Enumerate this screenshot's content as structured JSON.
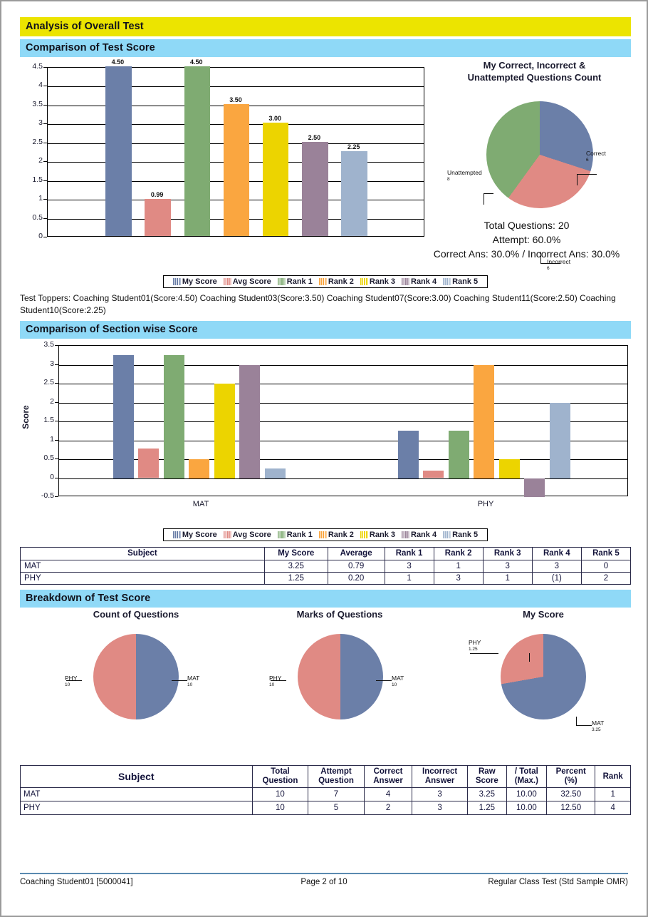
{
  "header": {
    "title": "Analysis of Overall Test"
  },
  "sections": {
    "test_score": {
      "title": "Comparison of Test Score"
    },
    "section_wise": {
      "title": "Comparison of Section wise Score"
    },
    "breakdown": {
      "title": "Breakdown of Test Score"
    }
  },
  "legend": {
    "items": [
      {
        "label": "My Score",
        "color": "#6b7fa8"
      },
      {
        "label": "Avg Score",
        "color": "#e08a84"
      },
      {
        "label": "Rank 1",
        "color": "#7fab72"
      },
      {
        "label": "Rank 2",
        "color": "#faa640"
      },
      {
        "label": "Rank 3",
        "color": "#ecd400"
      },
      {
        "label": "Rank 4",
        "color": "#9a8299"
      },
      {
        "label": "Rank 5",
        "color": "#9fb3cd"
      }
    ]
  },
  "toppers": {
    "text": "Test Toppers: Coaching Student01(Score:4.50) Coaching Student03(Score:3.50) Coaching Student07(Score:3.00) Coaching Student11(Score:2.50) Coaching Student10(Score:2.25)"
  },
  "overall_stats": {
    "total_questions": "Total Questions: 20",
    "attempt": "Attempt: 60.0%",
    "accuracy": "Correct Ans: 30.0% / Incorrect Ans: 30.0%"
  },
  "section_table": {
    "headers": [
      "Subject",
      "My Score",
      "Average",
      "Rank 1",
      "Rank 2",
      "Rank 3",
      "Rank 4",
      "Rank 5"
    ],
    "rows": [
      [
        "MAT",
        "3.25",
        "0.79",
        "3",
        "1",
        "3",
        "3",
        "0"
      ],
      [
        "PHY",
        "1.25",
        "0.20",
        "1",
        "3",
        "1",
        "(1)",
        "2"
      ]
    ]
  },
  "breakdown_table": {
    "headers": [
      "Subject",
      "Total Question",
      "Attempt Question",
      "Correct Answer",
      "Incorrect Answer",
      "Raw Score",
      "/ Total (Max.)",
      "Percent (%)",
      "Rank"
    ],
    "headers_l1": [
      "Subject",
      "Total",
      "Attempt",
      "Correct",
      "Incorrect",
      "Raw",
      "/ Total",
      "Percent",
      "Rank"
    ],
    "headers_l2": [
      "",
      "Question",
      "Question",
      "Answer",
      "Answer",
      "Score",
      "(Max.)",
      "(%)",
      ""
    ],
    "rows": [
      [
        "MAT",
        "10",
        "7",
        "4",
        "3",
        "3.25",
        "10.00",
        "32.50",
        "1"
      ],
      [
        "PHY",
        "10",
        "5",
        "2",
        "3",
        "1.25",
        "10.00",
        "12.50",
        "4"
      ]
    ]
  },
  "footer": {
    "left": "Coaching Student01 [5000041]",
    "center": "Page 2 of 10",
    "right": "Regular Class Test (Std Sample OMR)"
  },
  "chart_data": [
    {
      "id": "overall_bar",
      "type": "bar",
      "title": "",
      "categories": [
        "My Score",
        "Avg Score",
        "Rank 1",
        "Rank 2",
        "Rank 3",
        "Rank 4",
        "Rank 5"
      ],
      "values": [
        4.5,
        0.99,
        4.5,
        3.5,
        3.0,
        2.5,
        2.25
      ],
      "labels": [
        "4.50",
        "0.99",
        "4.50",
        "3.50",
        "3.00",
        "2.50",
        "2.25"
      ],
      "colors": [
        "#6b7fa8",
        "#e08a84",
        "#7fab72",
        "#faa640",
        "#ecd400",
        "#9a8299",
        "#9fb3cd"
      ],
      "ylim": [
        0,
        4.5
      ],
      "yticks": [
        "0",
        "0.5",
        "1",
        "1.5",
        "2",
        "2.5",
        "3",
        "3.5",
        "4",
        "4.5"
      ],
      "ylabel": "",
      "xlabel": "",
      "grid": true,
      "legend_position": "bottom"
    },
    {
      "id": "overall_pie",
      "type": "pie",
      "title": "My Correct, Incorrect & Unattempted Questions Count",
      "title_line1": "My Correct, Incorrect &",
      "title_line2": "Unattempted Questions Count",
      "labels": [
        "Correct",
        "Incorrect",
        "Unattempted"
      ],
      "values": [
        6,
        6,
        8
      ],
      "value_labels": [
        "6",
        "6",
        "8"
      ],
      "colors": [
        "#6b7fa8",
        "#e08a84",
        "#7fab72"
      ]
    },
    {
      "id": "section_bar",
      "type": "bar",
      "categories": [
        "MAT",
        "PHY"
      ],
      "ylabel": "Score",
      "ylim": [
        -0.5,
        3.5
      ],
      "yticks": [
        "-0.5",
        "0",
        "0.5",
        "1",
        "1.5",
        "2",
        "2.5",
        "3",
        "3.5"
      ],
      "grid": true,
      "legend_position": "bottom",
      "series": [
        {
          "name": "My Score",
          "color": "#6b7fa8",
          "values": [
            3.25,
            1.25
          ]
        },
        {
          "name": "Avg Score",
          "color": "#e08a84",
          "values": [
            0.79,
            0.2
          ]
        },
        {
          "name": "Rank 1",
          "color": "#7fab72",
          "values": [
            3.25,
            1.25
          ]
        },
        {
          "name": "Rank 2",
          "color": "#faa640",
          "values": [
            0.5,
            3.0
          ]
        },
        {
          "name": "Rank 3",
          "color": "#ecd400",
          "values": [
            2.5,
            0.5
          ]
        },
        {
          "name": "Rank 4",
          "color": "#9a8299",
          "values": [
            3.0,
            -0.5
          ]
        },
        {
          "name": "Rank 5",
          "color": "#9fb3cd",
          "values": [
            0.25,
            2.0
          ]
        }
      ]
    },
    {
      "id": "count_of_questions",
      "type": "pie",
      "title": "Count of Questions",
      "labels": [
        "MAT",
        "PHY"
      ],
      "values": [
        10,
        10
      ],
      "value_labels": [
        "10",
        "10"
      ],
      "colors": [
        "#6b7fa8",
        "#e08a84"
      ]
    },
    {
      "id": "marks_of_questions",
      "type": "pie",
      "title": "Marks of Questions",
      "labels": [
        "MAT",
        "PHY"
      ],
      "values": [
        10,
        10
      ],
      "value_labels": [
        "10",
        "10"
      ],
      "colors": [
        "#6b7fa8",
        "#e08a84"
      ]
    },
    {
      "id": "my_score_pie",
      "type": "pie",
      "title": "My Score",
      "labels": [
        "MAT",
        "PHY"
      ],
      "values": [
        3.25,
        1.25
      ],
      "value_labels": [
        "3.25",
        "1.25"
      ],
      "colors": [
        "#6b7fa8",
        "#e08a84"
      ]
    }
  ]
}
